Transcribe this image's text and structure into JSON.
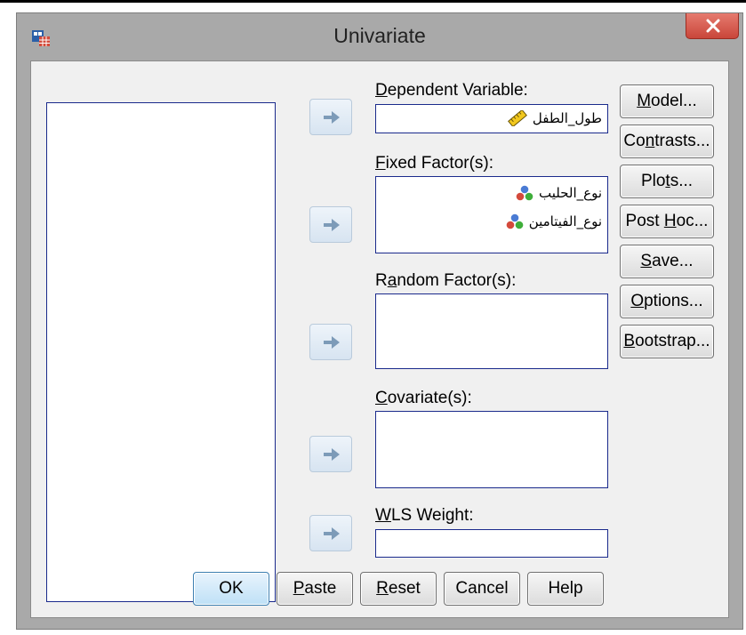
{
  "window": {
    "title": "Univariate"
  },
  "fields": {
    "dependent": {
      "label_u": "D",
      "label_rest": "ependent Variable:",
      "items": [
        {
          "name": "طول_الطفل",
          "icon": "ruler-scale-icon"
        }
      ]
    },
    "fixed": {
      "label_u": "F",
      "label_rest": "ixed Factor(s):",
      "items": [
        {
          "name": "نوع_الحليب",
          "icon": "nominal-measure-icon"
        },
        {
          "name": "نوع_الفيتامين",
          "icon": "nominal-measure-icon"
        }
      ]
    },
    "random": {
      "label_pre": "R",
      "label_u": "a",
      "label_rest": "ndom Factor(s):"
    },
    "covariate": {
      "label_u": "C",
      "label_rest": "ovariate(s):"
    },
    "wls": {
      "label_u": "W",
      "label_rest": "LS Weight:"
    }
  },
  "side_buttons": {
    "model": {
      "u": "M",
      "rest": "odel..."
    },
    "contrasts": {
      "pre": "Co",
      "u": "n",
      "rest": "trasts..."
    },
    "plots": {
      "pre": "Plo",
      "u": "t",
      "rest": "s..."
    },
    "posthoc": {
      "pre": "Post ",
      "u": "H",
      "rest": "oc..."
    },
    "save": {
      "u": "S",
      "rest": "ave..."
    },
    "options": {
      "u": "O",
      "rest": "ptions..."
    },
    "bootstrap": {
      "u": "B",
      "rest": "ootstrap..."
    }
  },
  "bottom_buttons": {
    "ok": {
      "text": "OK"
    },
    "paste": {
      "u": "P",
      "rest": "aste"
    },
    "reset": {
      "u": "R",
      "rest": "eset"
    },
    "cancel": {
      "text": "Cancel"
    },
    "help": {
      "text": "Help"
    }
  },
  "colors": {
    "window_frame": "#a9a9a9",
    "client_bg": "#f0f0f0",
    "list_border": "#1a2a8c",
    "close_button": "#c9463a",
    "default_button": "#bee0f6"
  }
}
